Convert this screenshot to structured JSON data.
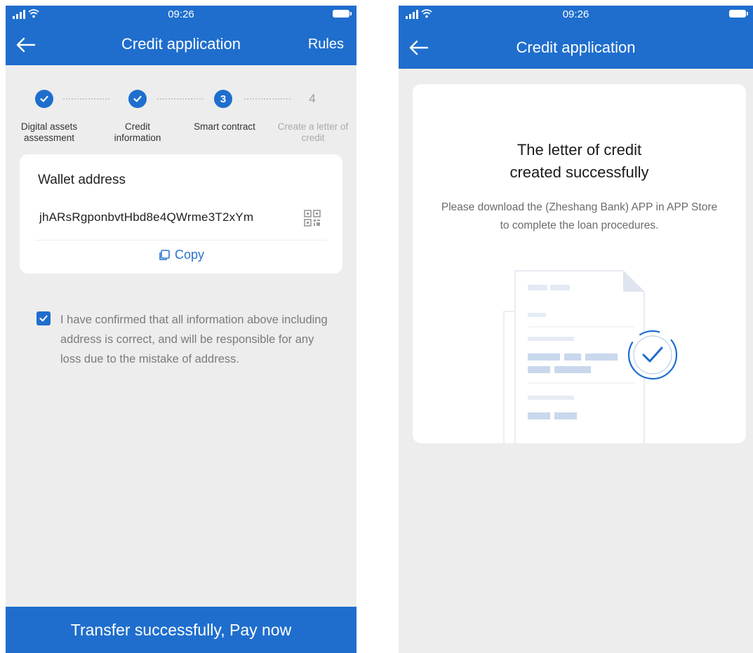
{
  "left_screen": {
    "status_bar": {
      "time": "09:26"
    },
    "header": {
      "title": "Credit application",
      "rules_label": "Rules"
    },
    "stepper": {
      "steps": [
        {
          "label": "Digital assets assessment",
          "state": "done"
        },
        {
          "label": "Credit information",
          "state": "done"
        },
        {
          "label": "Smart contract",
          "number": "3",
          "state": "current"
        },
        {
          "label": "Create a letter of credit",
          "number": "4",
          "state": "pending"
        }
      ]
    },
    "wallet_card": {
      "title": "Wallet address",
      "address": "jhARsRgponbvtHbd8e4QWrme3T2xYm",
      "copy_label": "Copy"
    },
    "confirmation": {
      "checked": true,
      "text": "I have confirmed that all information above including address is correct, and will be responsible for any loss due to the mistake of address."
    },
    "pay_button_label": "Transfer successfully, Pay now"
  },
  "right_screen": {
    "status_bar": {
      "time": "09:26"
    },
    "header": {
      "title": "Credit application"
    },
    "success": {
      "title": "The letter of credit created successfully",
      "description": "Please download the (Zheshang Bank) APP in APP Store to complete the loan procedures."
    }
  },
  "colors": {
    "primary": "#1f6ecd",
    "background": "#ededed",
    "card": "#ffffff",
    "muted_text": "#7b7b7b"
  },
  "icons": [
    "back-arrow-icon",
    "signal-icon",
    "wifi-icon",
    "battery-icon",
    "check-icon",
    "qr-code-icon",
    "copy-icon",
    "checkbox-checked-icon",
    "document-check-illustration"
  ]
}
